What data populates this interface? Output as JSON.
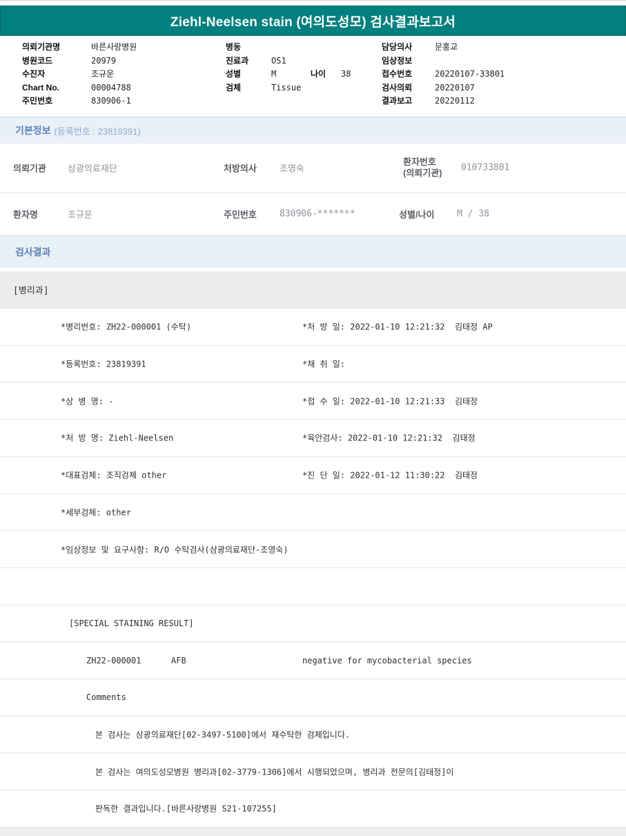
{
  "title_bar": {
    "title": "Ziehl-Neelsen stain (여의도성모) 검사결과보고서"
  },
  "colors": {
    "header_teal": "#00807e",
    "section_bg": "#e9f0f8",
    "section_title_blue": "#5e83b8",
    "dept_row_gray": "#ececec",
    "footer_gray": "#efefef"
  },
  "patient_header": {
    "col1": [
      {
        "label": "의뢰기관명",
        "value": "바른사랑병원"
      },
      {
        "label": "병원코드",
        "value": "20979"
      },
      {
        "label": "수진자",
        "value": "조규운"
      },
      {
        "label": "Chart No.",
        "value": "00004788"
      },
      {
        "label": "주민번호",
        "value": "830906-1"
      }
    ],
    "col2": [
      {
        "label": "병동",
        "value": ""
      },
      {
        "label": "진료과",
        "value": "OS1"
      },
      {
        "label": "성별",
        "value": "M",
        "label2": "나이",
        "value2": "38"
      },
      {
        "label": "검체",
        "value": "Tissue"
      }
    ],
    "col3": [
      {
        "label": "담당의사",
        "value": "문홍교"
      },
      {
        "label": "임상정보",
        "value": ""
      },
      {
        "label": "접수번호",
        "value": "20220107-33801"
      },
      {
        "label": "검사의뢰",
        "value": "20220107"
      },
      {
        "label": "결과보고",
        "value": "20220112"
      }
    ]
  },
  "basic_info": {
    "section_title": "기본정보",
    "section_suffix": "(등록번호 : 23819391)",
    "row1": {
      "c1_label": "의뢰기관",
      "c1_value": "삼광의료재단",
      "c2_label": "처방의사",
      "c2_value": "조영숙",
      "c3_label": "환자번호\n(의뢰기관)",
      "c3_value": "010733801"
    },
    "row2": {
      "c1_label": "환자명",
      "c1_value": "조규운",
      "c2_label": "주민번호",
      "c2_value": "830906-*******",
      "c3_label": "성별/나이",
      "c3_value": "M / 38"
    }
  },
  "results": {
    "section_title": "검사결과",
    "department": "[병리과]",
    "detail_rows": [
      {
        "left": "*병리번호: ZH22-000001 (수탁)",
        "right": "*처 방 일: 2022-01-10 12:21:32  김태정 AP"
      },
      {
        "left": "*등록번호: 23819391",
        "right": "*채 취 일:"
      },
      {
        "left": "*상 병 명: -",
        "right": "*접 수 일: 2022-01-10 12:21:33  김태정"
      },
      {
        "left": "*처 방 명: Ziehl-Neelsen",
        "right": "*육안검사: 2022-01-10 12:21:32  김태정"
      },
      {
        "left": "*대표검체: 조직검체 other",
        "right": "*진 단 일: 2022-01-12 11:30:22  김태정"
      },
      {
        "left": "*세부검체: other",
        "right": ""
      },
      {
        "left": "*임상정보 및 요구사항: R/O 수탁검사(삼광의료재단-조영숙)",
        "right": ""
      }
    ],
    "special_section_title": "[SPECIAL STAINING RESULT]",
    "special_row": {
      "code": "ZH22-000001",
      "stain": "AFB",
      "result": "negative for mycobacterial species"
    },
    "comments_label": "Comments",
    "comment_lines": [
      "본 검사는 삼광의료재단[02-3497-5100]에서 재수탁한 검체입니다.",
      "본 검사는 여의도성모병원 병리과[02-3779-1306]에서 시행되었으며, 병리과 전문의[김태정]이",
      "판독한 결과입니다.[바른사랑병원 S21-107255]"
    ]
  }
}
